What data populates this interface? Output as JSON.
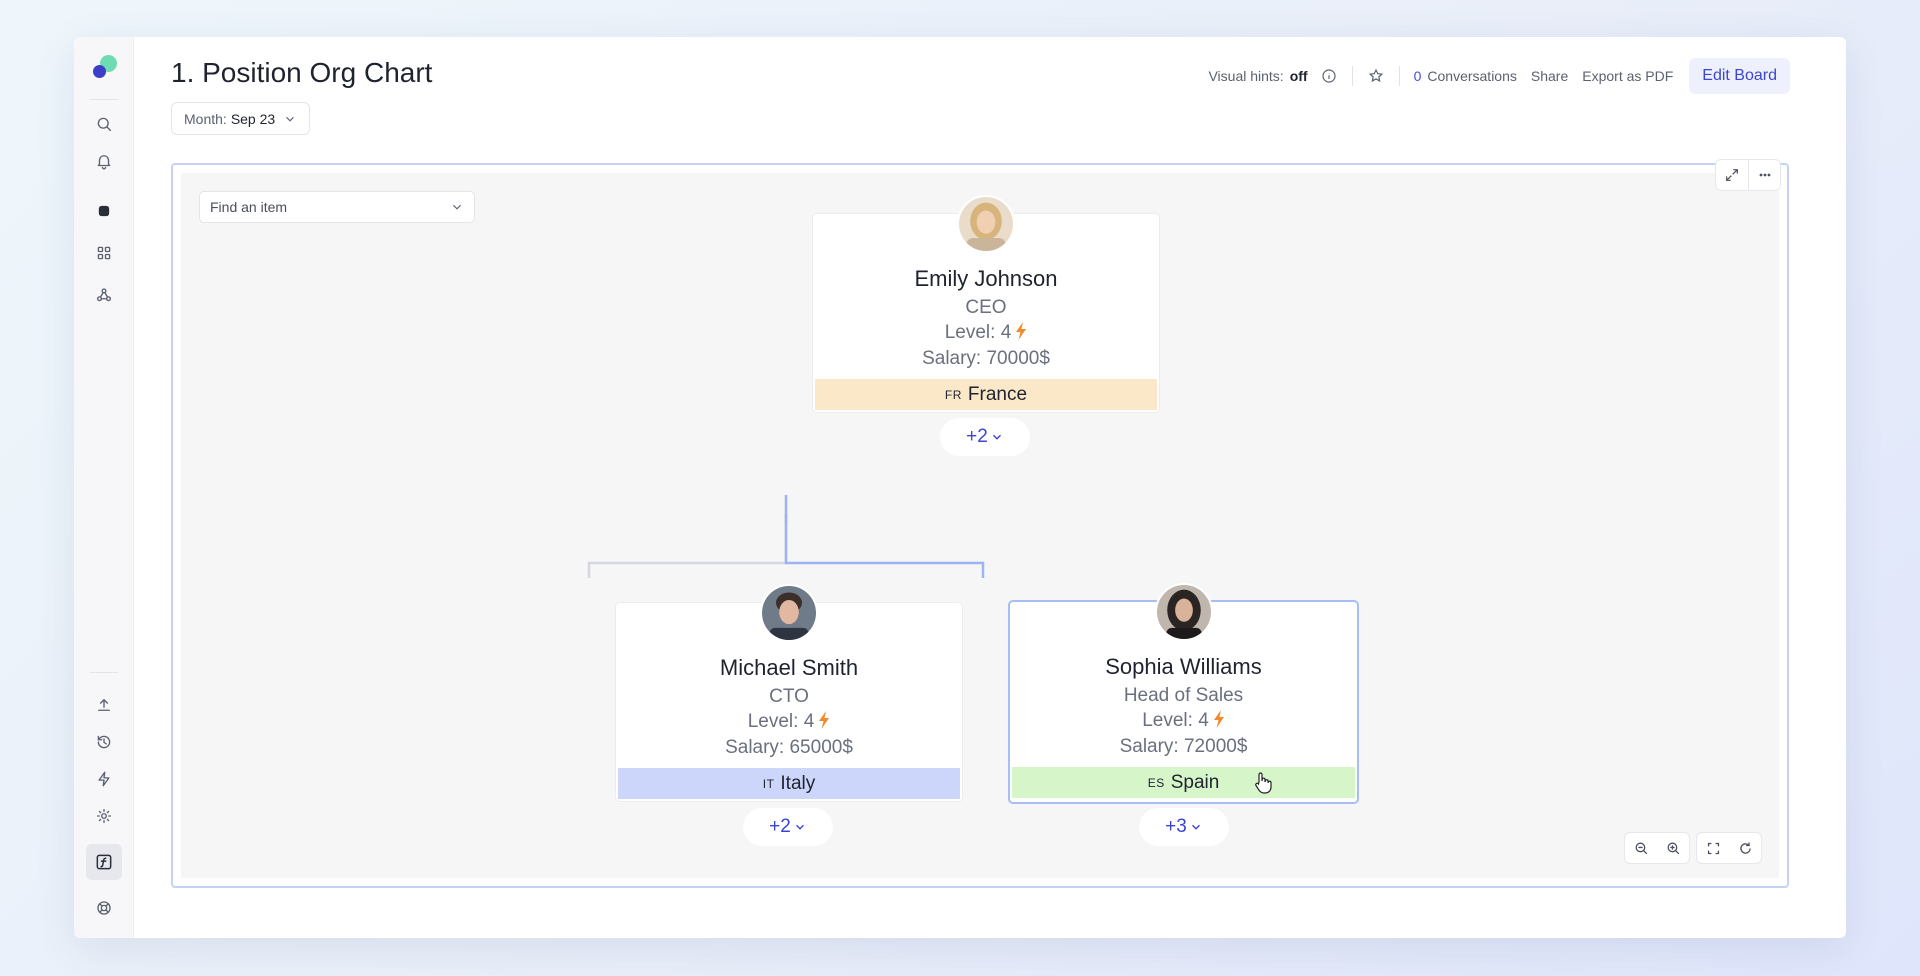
{
  "page": {
    "title": "1. Position Org Chart"
  },
  "filter": {
    "label": "Month:",
    "value": "Sep 23"
  },
  "topbar": {
    "visual_hints_label": "Visual hints:",
    "visual_hints_value": "off",
    "conversations_count": "0",
    "conversations_label": "Conversations",
    "share": "Share",
    "export": "Export as PDF",
    "edit": "Edit Board"
  },
  "search": {
    "placeholder": "Find an item"
  },
  "nodes": {
    "ceo": {
      "name": "Emily Johnson",
      "role": "CEO",
      "level": "Level: 4",
      "salary": "Salary: 70000$",
      "country_code": "FR",
      "country": "France",
      "country_color": "#fbe8c8",
      "expand": "+2"
    },
    "cto": {
      "name": "Michael Smith",
      "role": "CTO",
      "level": "Level: 4",
      "salary": "Salary: 65000$",
      "country_code": "IT",
      "country": "Italy",
      "country_color": "#ccd5fa",
      "expand": "+2"
    },
    "sales": {
      "name": "Sophia Williams",
      "role": "Head of Sales",
      "level": "Level: 4",
      "salary": "Salary: 72000$",
      "country_code": "ES",
      "country": "Spain",
      "country_color": "#d6f5c9",
      "expand": "+3"
    }
  },
  "colors": {
    "accent": "#3a46d3",
    "bolt": "#f08a2c",
    "connector_active": "#9cb3f4",
    "connector": "#d3d7e0"
  }
}
